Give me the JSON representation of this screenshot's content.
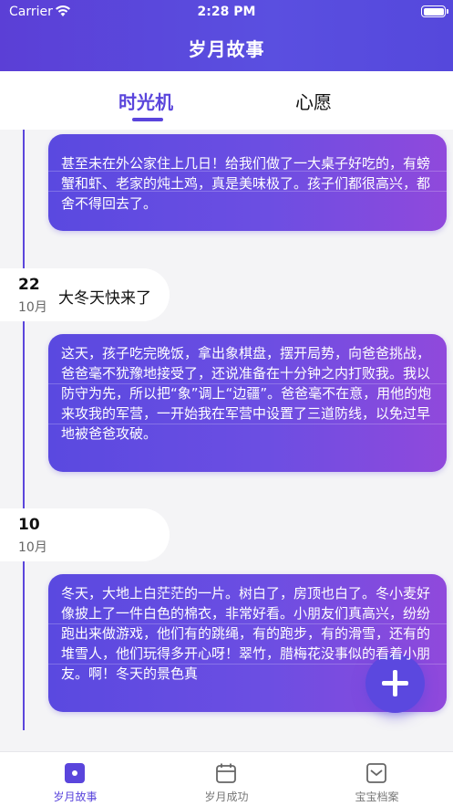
{
  "status_bar": {
    "carrier": "Carrier",
    "time": "2:28 PM"
  },
  "header": {
    "title": "岁月故事"
  },
  "tabs": [
    {
      "label": "时光机",
      "active": true
    },
    {
      "label": "心愿",
      "active": false
    }
  ],
  "entries": [
    {
      "text": "甚至未在外公家住上几日！给我们做了一大桌子好吃的，有螃蟹和虾、老家的炖土鸡，真是美味极了。孩子们都很高兴，都舍不得回去了。"
    },
    {
      "day": "22",
      "month": "10月",
      "title": "大冬天快来了",
      "text": "这天，孩子吃完晚饭，拿出象棋盘，摆开局势，向爸爸挑战，爸爸毫不犹豫地接受了，还说准备在十分钟之内打败我。我以防守为先，所以把“象”调上“边疆”。爸爸毫不在意，用他的炮来攻我的军营，一开始我在军营中设置了三道防线，以免过早地被爸爸攻破。"
    },
    {
      "day": "10",
      "month": "10月",
      "title": "",
      "text": "冬天，大地上白茫茫的一片。树白了，房顶也白了。冬小麦好像披上了一件白色的棉衣，非常好看。小朋友们真高兴，纷纷跑出来做游戏，他们有的跳绳，有的跑步，有的滑雪，还有的堆雪人，他们玩得多开心呀！翠竹，腊梅花没事似的看着小朋友。啊！冬天的景色真"
    }
  ],
  "bottom_nav": [
    {
      "label": "岁月故事",
      "icon": "story-icon",
      "active": true
    },
    {
      "label": "岁月成功",
      "icon": "calendar-icon",
      "active": false
    },
    {
      "label": "宝宝档案",
      "icon": "archive-icon",
      "active": false
    }
  ],
  "colors": {
    "accent": "#5a45dc",
    "card_start": "#5a49e0",
    "card_end": "#9049dc"
  }
}
